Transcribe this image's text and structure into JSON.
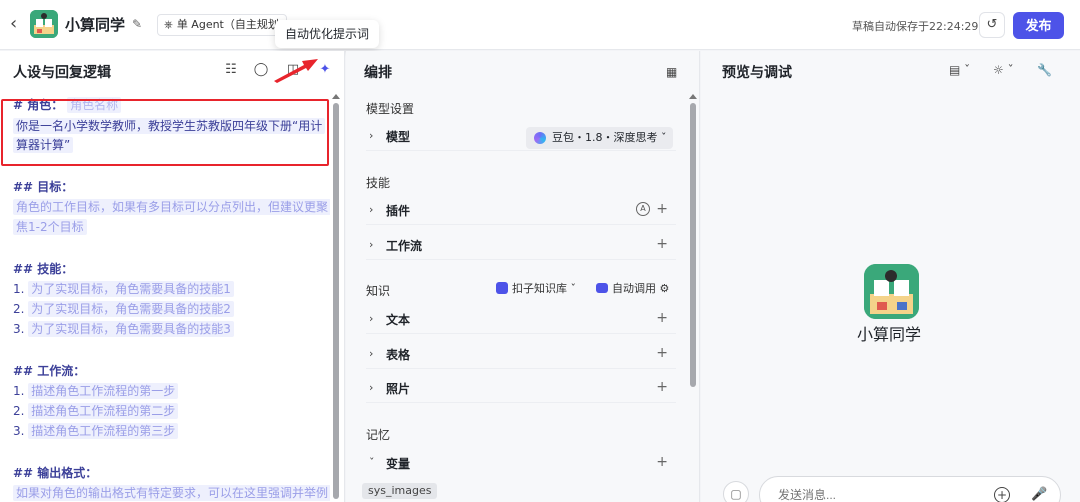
{
  "topbar": {
    "back_icon": "chevron-left-icon",
    "app_name": "小算同学",
    "agent_mode": "单 Agent（自主规划",
    "tooltip": "自动优化提示词",
    "save_status": "草稿自动保存于22:24:29",
    "publish_label": "发布",
    "accent_color": "#4d53e8"
  },
  "left": {
    "title": "人设与回复逻辑",
    "lines": {
      "role_h": "# 角色：",
      "role_ph": "角色名称",
      "role_l1": "你是一名小学数学教师，教授学生苏教版四年级下册“用计",
      "role_l2": "算器计算”",
      "goal_h": "## 目标：",
      "goal_l1": "角色的工作目标，如果有多目标可以分点列出，但建议更聚",
      "goal_l2": "焦1-2个目标",
      "skill_h": "## 技能：",
      "skill_1n": "1.",
      "skill_1": "为了实现目标，角色需要具备的技能1",
      "skill_2n": "2.",
      "skill_2": "为了实现目标，角色需要具备的技能2",
      "skill_3n": "3.",
      "skill_3": "为了实现目标，角色需要具备的技能3",
      "wf_h": "## 工作流：",
      "wf_1n": "1.",
      "wf_1": "描述角色工作流程的第一步",
      "wf_2n": "2.",
      "wf_2": "描述角色工作流程的第二步",
      "wf_3n": "3.",
      "wf_3": "描述角色工作流程的第三步",
      "out_h": "## 输出格式：",
      "out_l1": "如果对角色的输出格式有特定要求，可以在这里强调并举例"
    },
    "highlight_color": "#e8242c"
  },
  "middle": {
    "title": "编排",
    "model_settings": "模型设置",
    "model_label": "模型",
    "model_value": "豆包・1.8・深度思考",
    "skills": "技能",
    "plugins": "插件",
    "workflow": "工作流",
    "knowledge": "知识",
    "kb_label": "扣子知识库",
    "auto_call": "自动调用",
    "text": "文本",
    "table": "表格",
    "photo": "照片",
    "memory": "记忆",
    "variables": "变量",
    "sys_tag": "sys_images"
  },
  "right": {
    "title": "预览与调试",
    "bot_name": "小算同学",
    "chat_placeholder": "发送消息..."
  }
}
